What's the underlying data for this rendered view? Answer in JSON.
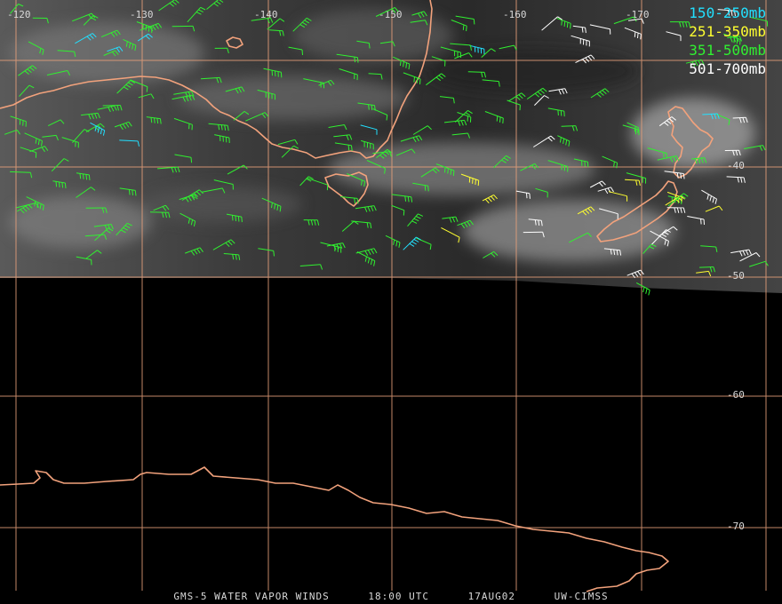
{
  "map": {
    "longitude_labels": [
      "-120",
      "-130",
      "-140",
      "-150",
      "-160",
      "-170"
    ],
    "latitude_labels": [
      "-40",
      "-50",
      "-60",
      "-70"
    ],
    "legend": [
      {
        "label": "150-250mb",
        "color": "#22e0ff"
      },
      {
        "label": "251-350mb",
        "color": "#ffff30"
      },
      {
        "label": "351-500mb",
        "color": "#30f030"
      },
      {
        "label": "501-700mb",
        "color": "#ffffff"
      }
    ],
    "footer": {
      "product": "GMS-5 WATER VAPOR WINDS",
      "time": "18:00 UTC",
      "date": "17AUG02",
      "source": "UW-CIMSS"
    },
    "colors": {
      "coastline": "#f2a27c",
      "grid": "#e8a07a",
      "background": "#000000"
    }
  }
}
